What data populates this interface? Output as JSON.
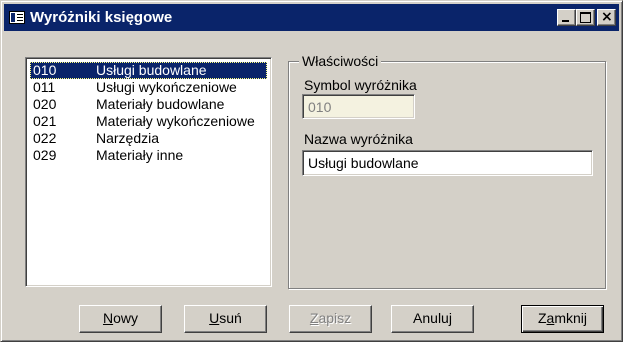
{
  "window": {
    "title": "Wyróżniki księgowe"
  },
  "list": {
    "items": [
      {
        "code": "010",
        "name": "Usługi budowlane",
        "selected": true
      },
      {
        "code": "011",
        "name": "Usługi wykończeniowe",
        "selected": false
      },
      {
        "code": "020",
        "name": "Materiały budowlane",
        "selected": false
      },
      {
        "code": "021",
        "name": "Materiały wykończeniowe",
        "selected": false
      },
      {
        "code": "022",
        "name": "Narzędzia",
        "selected": false
      },
      {
        "code": "029",
        "name": "Materiały inne",
        "selected": false
      }
    ]
  },
  "properties": {
    "group_label": "Właściwości",
    "symbol_label": "Symbol wyróżnika",
    "symbol_value": "010",
    "name_label": "Nazwa wyróżnika",
    "name_value": "Usługi budowlane"
  },
  "buttons": {
    "nowy": {
      "mnemonic": "N",
      "rest": "owy"
    },
    "usun": {
      "mnemonic": "U",
      "rest": "suń"
    },
    "zapisz": {
      "mnemonic": "Z",
      "rest": "apisz",
      "disabled": true
    },
    "anuluj": {
      "label": "Anuluj"
    },
    "zamknij": {
      "pre": "Z",
      "mnemonic": "a",
      "rest": "mknij"
    }
  },
  "colors": {
    "titlebar": "#0a246a",
    "window_face": "#d4d0c8",
    "selection": "#0a246a"
  }
}
